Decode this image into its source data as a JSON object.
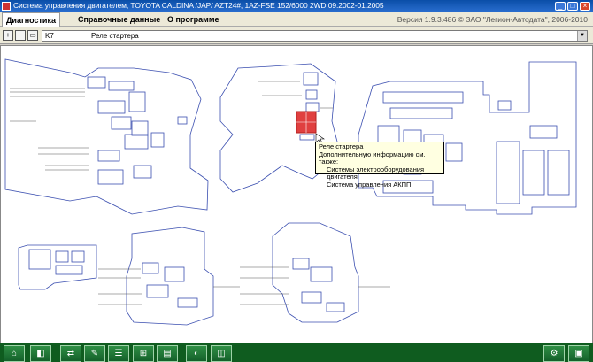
{
  "window": {
    "title": "Система управления двигателем, TOYOTA  CALDINA /JAP/  AZT24#,   1AZ-FSE  152/6000  2WD  09.2002-01.2005",
    "min": "_",
    "max": "□",
    "close": "×"
  },
  "menu": {
    "items": [
      "Диагностика",
      "Справочные данные",
      "О программе"
    ],
    "version": "Версия 1.9.3.486 © ЗАО \"Легион-Автодата\", 2006-2010"
  },
  "toolbar": {
    "zoom_in": "+",
    "zoom_out": "−",
    "fit": "▭",
    "component_code": "K7",
    "component_name": "Реле стартера",
    "dropdown": "▼"
  },
  "tooltip": {
    "title": "Реле стартера",
    "subtitle": "Дополнительную информацию см. также:",
    "links": [
      "Системы электрооборудования двигателя",
      "Система управления АКПП"
    ]
  },
  "taskbar": {
    "buttons": [
      "⌂",
      "◧",
      "⇄",
      "✎",
      "☰",
      "⊞",
      "▤",
      "◐",
      "◫",
      "⚙",
      "▣",
      "◨"
    ]
  },
  "colors": {
    "title_bar": "#0a4ea8",
    "diagram_line": "#3b4fb0",
    "highlight": "#e04040",
    "tooltip_bg": "#ffffe1",
    "taskbar": "#0f5c1f"
  }
}
